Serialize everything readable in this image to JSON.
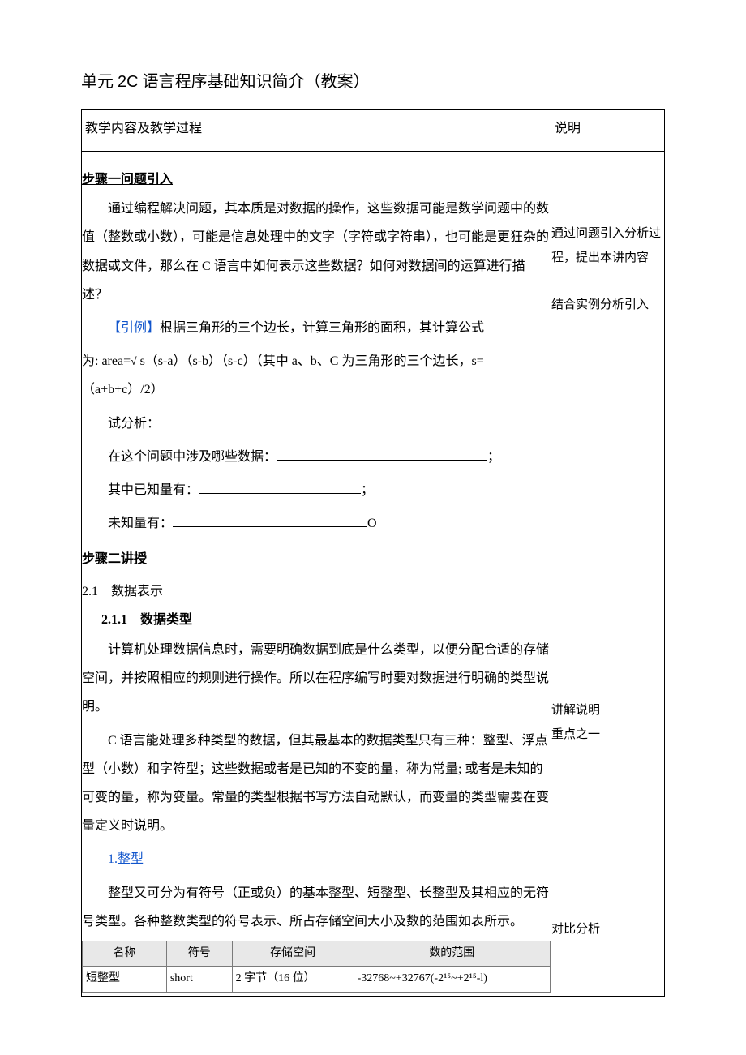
{
  "title_prefix": "单元 ",
  "title_unit": "2C",
  "title_rest": " 语言程序基础知识简介（教案）",
  "header_left": "教学内容及教学过程",
  "header_right": "说明",
  "step1_title": "步骤一问题引入",
  "p1": "通过编程解决问题，其本质是对数据的操作，这些数据可能是数学问题中的数值（整数或小数），可能是信息处理中的文字（字符或字符串），也可能是更狂杂的数据或文件，那么在 C 语言中如何表示这些数据？如何对数据间的运算进行描述？",
  "example_label": "【引例】",
  "example_text": "根据三角形的三个边长，计算三角形的面积，其计算公式",
  "formula_prefix": "为: area=",
  "formula_mid": "s（s-a）（s-b）（s-c）",
  "formula_suffix": "（其中 a、b、C 为三角形的三个边长，s=（a+b+c）/2）",
  "analyze_label": "试分析：",
  "q1_prefix": "在这个问题中涉及哪些数据：",
  "q1_suffix": "；",
  "q2_prefix": "其中已知量有：",
  "q2_suffix": "；",
  "q3_prefix": "未知量有：",
  "q3_suffix": "O",
  "step2_title": "步骤二讲授",
  "sec_2_1": "2.1　数据表示",
  "sec_2_1_1": "2.1.1　数据类型",
  "p2": "计算机处理数据信息时，需要明确数据到底是什么类型，以便分配合适的存储空间，并按照相应的规则进行操作。所以在程序编写时要对数据进行明确的类型说明。",
  "p3": "C 语言能处理多种类型的数据，但其最基本的数据类型只有三种：整型、浮点型（小数）和字符型；这些数据或者是已知的不变的量，称为常量; 或者是未知的可变的量，称为变量。常量的类型根据书写方法自动默认，而变量的类型需要在变量定义时说明。",
  "int_heading": "1.整型",
  "p4": "整型又可分为有符号（正或负）的基本整型、短整型、长整型及其相应的无符号类型。各种整数类型的符号表示、所占存储空间大小及数的范围如表所示。",
  "table": {
    "h1": "名称",
    "h2": "符号",
    "h3": "存储空间",
    "h4": "数的范围",
    "r1c1": "短整型",
    "r1c2": "short",
    "r1c3": "2 字节（16 位）",
    "r1c4": "-32768~+32767(-2¹⁵~+2¹⁵-l)"
  },
  "side1": "通过问题引入分析过程，提出本讲内容",
  "side2": "结合实例分析引入",
  "side3a": "讲解说明",
  "side3b": "重点之一",
  "side4": "对比分析"
}
